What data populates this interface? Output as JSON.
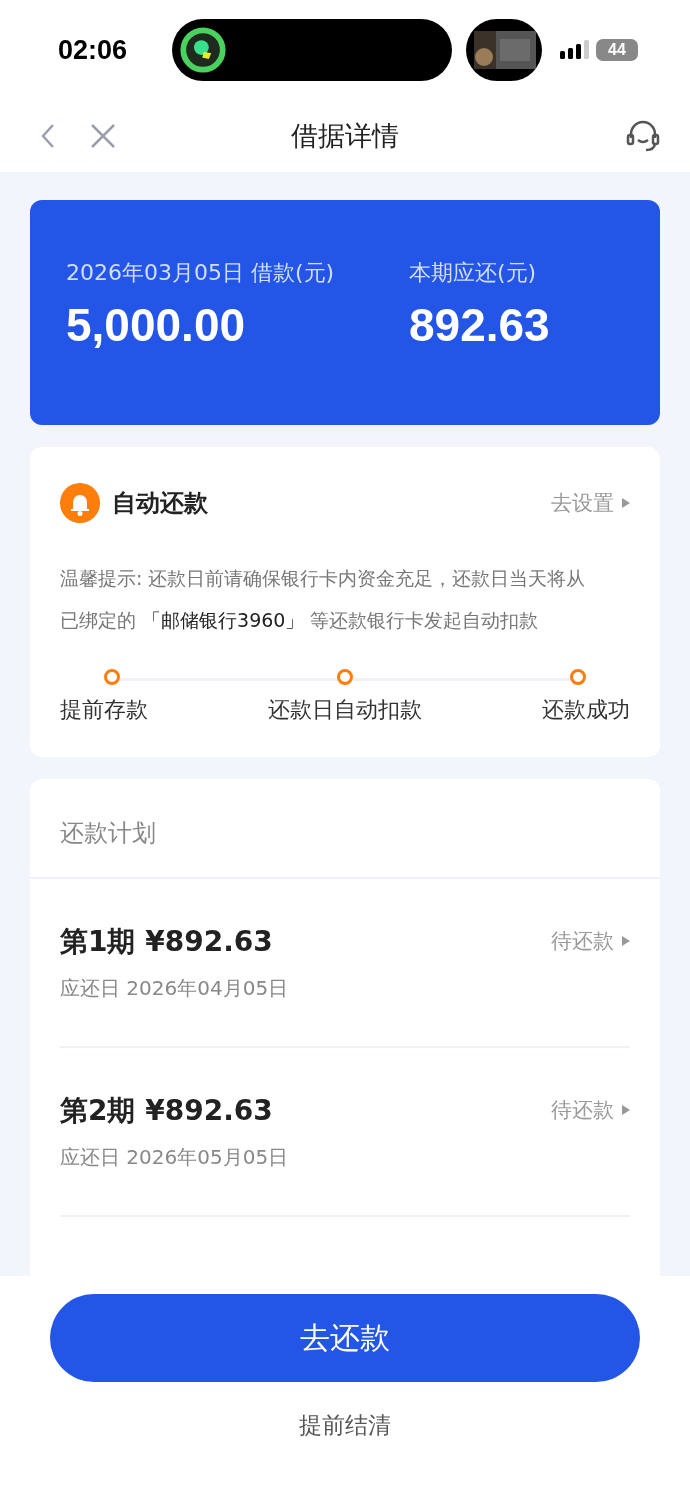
{
  "status_bar": {
    "time": "02:06",
    "battery": "44"
  },
  "nav": {
    "title": "借据详情"
  },
  "summary": {
    "loan_label": "2026年03月05日 借款(元)",
    "loan_amount": "5,000.00",
    "due_label": "本期应还(元)",
    "due_amount": "892.63"
  },
  "auto_repay": {
    "title": "自动还款",
    "action": "去设置",
    "notice": "温馨提示: 还款日前请确保银行卡内资金充足，还款日当天将从已绑定的 **「邮储银行3960」** 等还款银行卡发起自动扣款",
    "steps": [
      "提前存款",
      "还款日自动扣款",
      "还款成功"
    ]
  },
  "plan": {
    "title": "还款计划",
    "items": [
      {
        "period": "第1期",
        "amount": "¥892.63",
        "due_date": "应还日 2026年04月05日",
        "status": "待还款"
      },
      {
        "period": "第2期",
        "amount": "¥892.63",
        "due_date": "应还日 2026年05月05日",
        "status": "待还款"
      }
    ]
  },
  "footer": {
    "primary_button": "去还款",
    "secondary_link": "提前结清"
  }
}
